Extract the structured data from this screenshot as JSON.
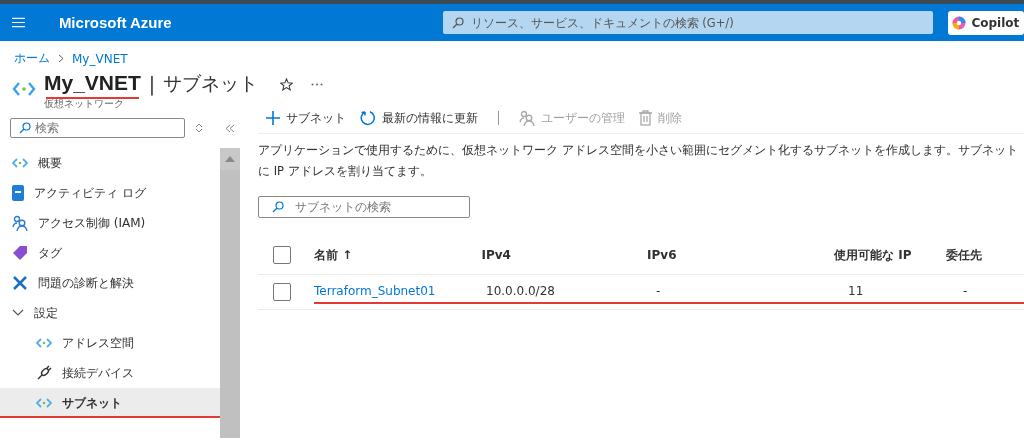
{
  "topbar": {
    "brand": "Microsoft Azure",
    "search": {
      "placeholder": "リソース、サービス、ドキュメントの検索 (G+/)"
    },
    "copilot_button": "Copilot"
  },
  "breadcrumb": [
    {
      "label": "ホーム"
    },
    {
      "label": "My_VNET"
    }
  ],
  "header": {
    "name": "My_VNET",
    "name_underlined": true,
    "separator": "|",
    "page": "サブネット",
    "subtitle": "仮想ネットワーク",
    "favorite": false
  },
  "sidebar": {
    "search": {
      "placeholder": "検索"
    },
    "items": [
      {
        "label": "概要",
        "selected": false,
        "underlined": false
      },
      {
        "label": "アクティビティ ログ",
        "selected": false,
        "underlined": false
      },
      {
        "label": "アクセス制御 (IAM)",
        "selected": false,
        "underlined": false
      },
      {
        "label": "タグ",
        "selected": false,
        "underlined": false
      },
      {
        "label": "問題の診断と解決",
        "selected": false,
        "underlined": false
      },
      {
        "label": "設定",
        "selected": false,
        "underlined": false,
        "expanded": true,
        "children": [
          {
            "label": "アドレス空間",
            "selected": false,
            "underlined": false
          },
          {
            "label": "接続デバイス",
            "selected": false,
            "underlined": false
          },
          {
            "label": "サブネット",
            "selected": true,
            "underlined": true
          }
        ]
      }
    ]
  },
  "toolbar": [
    {
      "label": "サブネット",
      "disabled": false
    },
    {
      "label": "最新の情報に更新",
      "disabled": false
    },
    {
      "label": "ユーザーの管理",
      "disabled": true
    },
    {
      "label": "削除",
      "disabled": true
    }
  ],
  "description": [
    "アプリケーションで使用するために、仮想ネットワーク アドレス空間を小さい範囲にセグメント化するサブネットを作成します。サブネット",
    "に IP アドレスを割り当てます。"
  ],
  "filter": {
    "placeholder": "サブネットの検索"
  },
  "table": {
    "columns": [
      "名前 ↑",
      "IPv4",
      "IPv6",
      "使用可能な IP",
      "委任先"
    ],
    "select_all_checked": false,
    "rows": [
      {
        "checked": false,
        "underlined": true,
        "cells": [
          "Terraform_Subnet01",
          "10.0.0.0/28",
          "-",
          "11",
          "-"
        ]
      }
    ]
  }
}
